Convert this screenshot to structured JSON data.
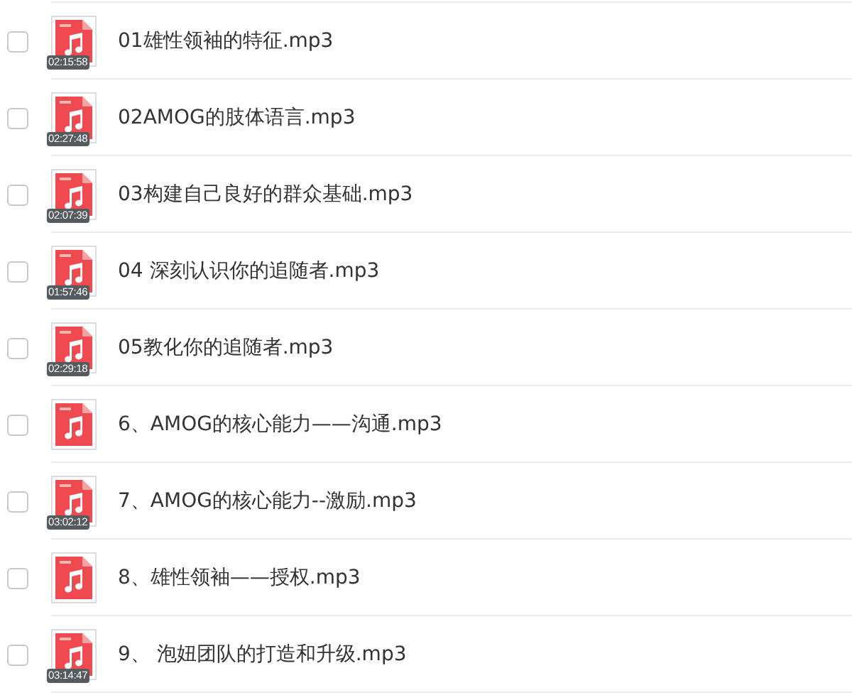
{
  "files": [
    {
      "name": "01雄性领袖的特征.mp3",
      "duration": "02:15:58",
      "checked": false
    },
    {
      "name": "02AMOG的肢体语言.mp3",
      "duration": "02:27:48",
      "checked": false
    },
    {
      "name": "03构建自己良好的群众基础.mp3",
      "duration": "02:07:39",
      "checked": false
    },
    {
      "name": "04 深刻认识你的追随者.mp3",
      "duration": "01:57:46",
      "checked": false
    },
    {
      "name": "05教化你的追随者.mp3",
      "duration": "02:29:18",
      "checked": false
    },
    {
      "name": "6、AMOG的核心能力——沟通.mp3",
      "checked": false
    },
    {
      "name": "7、AMOG的核心能力--激励.mp3",
      "duration": "03:02:12",
      "checked": false
    },
    {
      "name": "8、雄性领袖——授权.mp3",
      "checked": false
    },
    {
      "name": "9、 泡妞团队的打造和升级.mp3",
      "duration": "03:14:47",
      "checked": false
    }
  ]
}
